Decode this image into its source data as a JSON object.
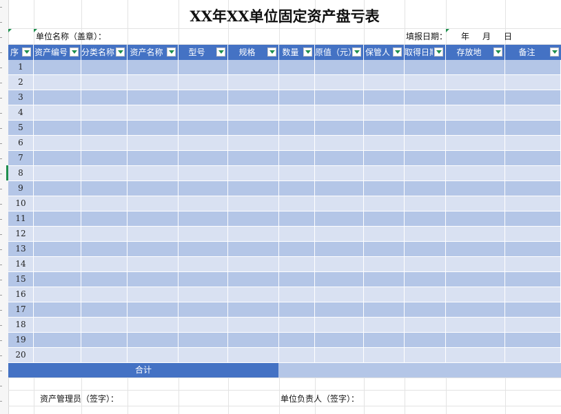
{
  "title": "XX年XX单位固定资产盘亏表",
  "unit_label": "单位名称（盖章）：",
  "date_label": "填报日期：",
  "date_year": "年",
  "date_month": "月",
  "date_day": "日",
  "columns": [
    {
      "label": "序"
    },
    {
      "label": "资产编号"
    },
    {
      "label": "分类名称"
    },
    {
      "label": "资产名称"
    },
    {
      "label": "型号"
    },
    {
      "label": "规格"
    },
    {
      "label": "数量"
    },
    {
      "label": "原值（元）"
    },
    {
      "label": "保管人"
    },
    {
      "label": "取得日期"
    },
    {
      "label": "存放地"
    },
    {
      "label": "备注"
    }
  ],
  "row_numbers": [
    "1",
    "2",
    "3",
    "4",
    "5",
    "6",
    "7",
    "8",
    "9",
    "10",
    "11",
    "12",
    "13",
    "14",
    "15",
    "16",
    "17",
    "18",
    "19",
    "20"
  ],
  "total_label": "合计",
  "asset_manager_label": "资产管理员（签字）：",
  "unit_head_label": "单位负责人（签字）：",
  "colors": {
    "header": "#4472c4",
    "row_dark": "#b4c6e7",
    "row_light": "#d9e1f2",
    "filter_arrow": "#1f8f4e"
  }
}
